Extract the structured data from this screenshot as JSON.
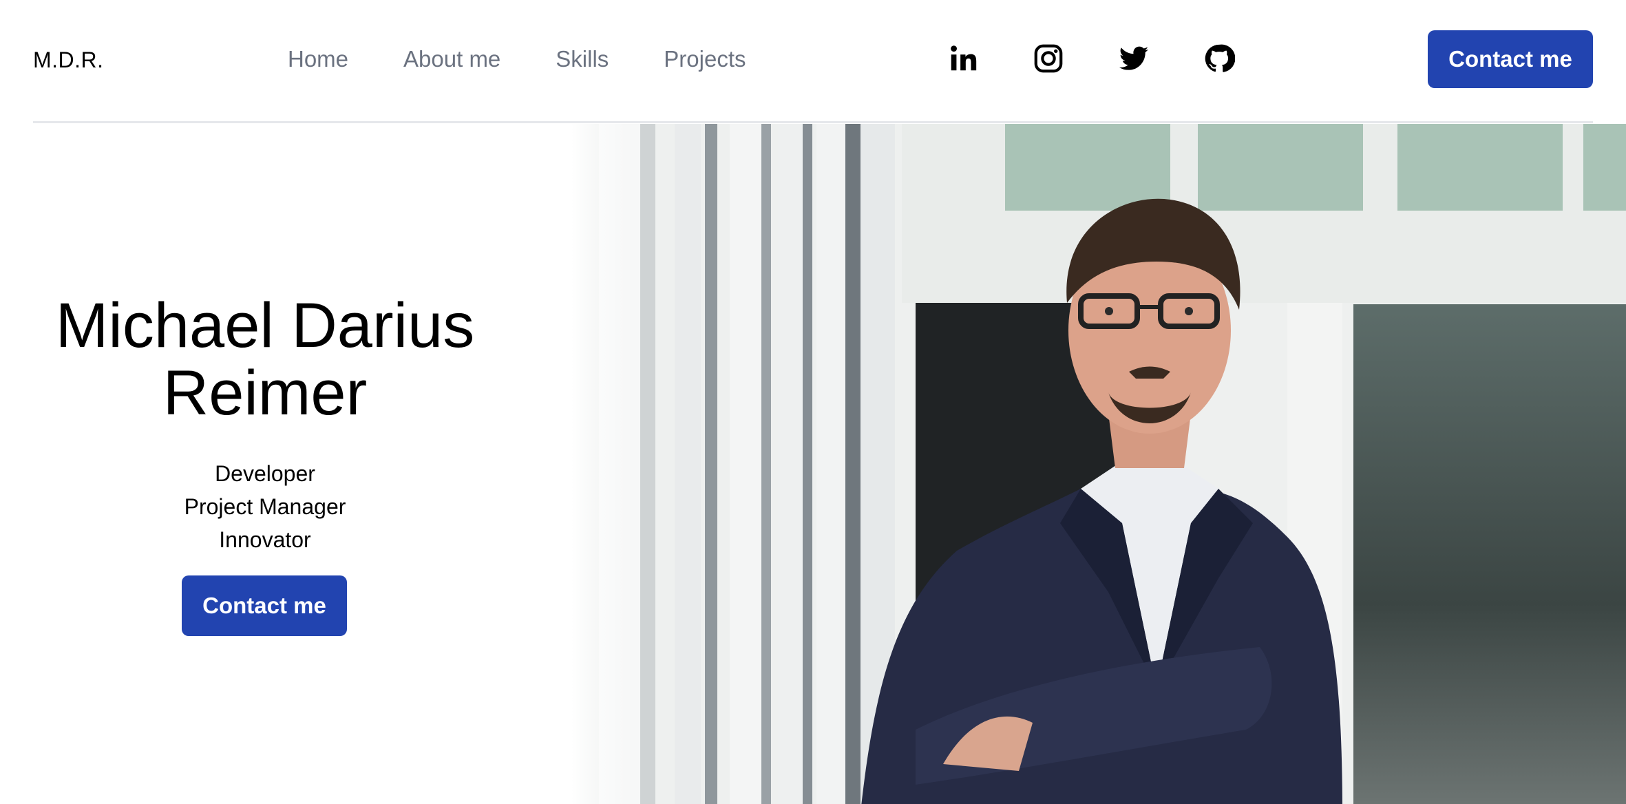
{
  "header": {
    "logo": "M.D.R.",
    "nav": [
      {
        "label": "Home"
      },
      {
        "label": "About me"
      },
      {
        "label": "Skills"
      },
      {
        "label": "Projects"
      }
    ],
    "socials": [
      {
        "name": "linkedin-icon"
      },
      {
        "name": "instagram-icon"
      },
      {
        "name": "twitter-icon"
      },
      {
        "name": "github-icon"
      }
    ],
    "contact_label": "Contact me"
  },
  "hero": {
    "name_line1": "Michael Darius",
    "name_line2": "Reimer",
    "roles": [
      "Developer",
      "Project Manager",
      "Innovator"
    ],
    "contact_label": "Contact me"
  },
  "colors": {
    "accent": "#2244b0",
    "nav_text": "#6b7280"
  }
}
